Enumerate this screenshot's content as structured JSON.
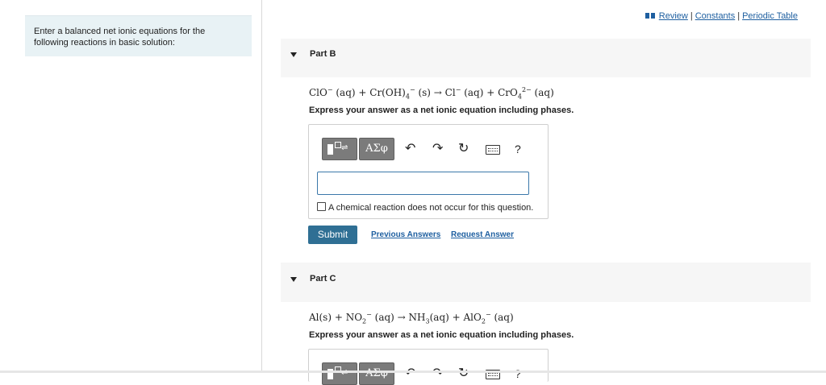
{
  "instructions": "Enter a balanced net ionic equations for the following reactions in basic solution:",
  "toplinks": {
    "review": "Review",
    "constants": "Constants",
    "periodic_table": "Periodic Table",
    "separator": "|"
  },
  "partB": {
    "title": "Part B",
    "eq": {
      "t1": "ClO",
      "s1": "−",
      "t2": " (aq) + Cr(OH)",
      "sb2": "4",
      "s2": "−",
      "t3": " (s) → Cl",
      "s3": "−",
      "t4": " (aq) + CrO",
      "sb4": "4",
      "s4": "2−",
      "t5": " (aq)"
    },
    "express": "Express your answer as a net ionic equation including phases.",
    "toolbar": {
      "greek": "ΑΣφ",
      "undo": "↶",
      "redo": "↷",
      "reset": "↻",
      "help": "?"
    },
    "no_reaction_label": "A chemical reaction does not occur for this question.",
    "submit": "Submit",
    "previous_answers": "Previous Answers",
    "request_answer": "Request Answer"
  },
  "partC": {
    "title": "Part C",
    "eq": {
      "t1": "Al(s) + NO",
      "sb1": "2",
      "s1": "−",
      "t2": " (aq) → NH",
      "sb2": "3",
      "t3": "(aq) + AlO",
      "sb3": "2",
      "s3": "−",
      "t4": " (aq)"
    },
    "express": "Express your answer as a net ionic equation including phases.",
    "toolbar": {
      "greek": "ΑΣφ",
      "undo": "↶",
      "redo": "↷",
      "reset": "↻",
      "help": "?"
    }
  }
}
